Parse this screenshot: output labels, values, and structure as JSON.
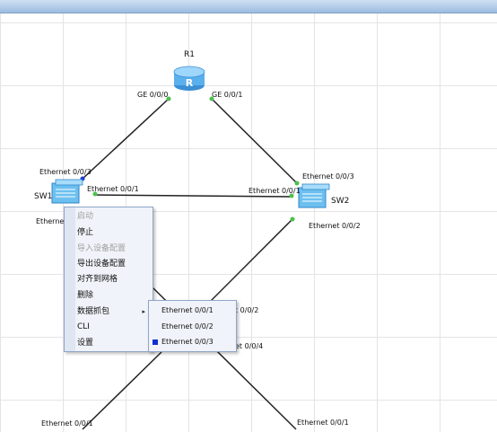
{
  "devices": {
    "r1": {
      "name": "R1"
    },
    "sw1": {
      "name": "SW1"
    },
    "sw2": {
      "name": "SW2"
    }
  },
  "ports": {
    "r1_ge000": "GE 0/0/0",
    "r1_ge001": "GE 0/0/1",
    "sw1_e003": "Ethernet 0/0/3",
    "sw1_e001": "Ethernet 0/0/1",
    "sw1_e_partial": "Ethernet",
    "sw2_e003": "Ethernet 0/0/3",
    "sw2_e001": "Ethernet 0/0/1",
    "sw2_e002": "Ethernet 0/0/2",
    "mid_e002": "t 0/0/2",
    "mid_e004": "et 0/0/4",
    "bottom_left_e001": "Ethernet 0/0/1",
    "bottom_right_e001": "Ethernet 0/0/1"
  },
  "context_menu": {
    "items": [
      {
        "label": "启动",
        "enabled": false
      },
      {
        "label": "停止",
        "enabled": true
      },
      {
        "label": "导入设备配置",
        "enabled": false
      },
      {
        "label": "导出设备配置",
        "enabled": true
      },
      {
        "label": "对齐到网格",
        "enabled": true
      },
      {
        "label": "删除",
        "enabled": true
      },
      {
        "label": "数据抓包",
        "enabled": true,
        "submenu": true
      },
      {
        "label": "CLI",
        "enabled": true
      },
      {
        "label": "设置",
        "enabled": true
      }
    ]
  },
  "submenu": {
    "items": [
      {
        "label": "Ethernet 0/0/1",
        "selected": false
      },
      {
        "label": "Ethernet 0/0/2",
        "selected": false
      },
      {
        "label": "Ethernet 0/0/3",
        "selected": true
      }
    ]
  },
  "icons": {
    "submenu_arrow": "▸"
  },
  "colors": {
    "port_up": "#4cc14c",
    "port_capture": "#1a3ad0",
    "link": "#222222",
    "device": "#4aa8e8"
  }
}
